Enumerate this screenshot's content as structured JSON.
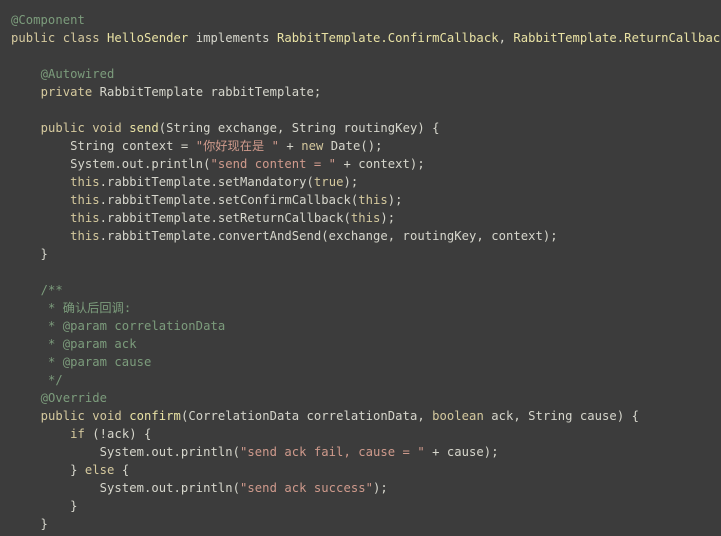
{
  "editor": {
    "language": "Java",
    "colors": {
      "background": "#3c3c3c",
      "plain": "#d6d6cc",
      "keyword": "#d5c99e",
      "declaration": "#e9e2a4",
      "string": "#cf9a8c",
      "annotation": "#7c9c7c",
      "comment": "#7c9c7c"
    },
    "lines": [
      [
        [
          "ann",
          "@Component"
        ]
      ],
      [
        [
          "kw",
          "public class "
        ],
        [
          "decl",
          "HelloSender"
        ],
        [
          "plain",
          " implements "
        ],
        [
          "decl",
          "RabbitTemplate.ConfirmCallback"
        ],
        [
          "plain",
          ", "
        ],
        [
          "decl",
          "RabbitTemplate.ReturnCallback"
        ],
        [
          "plain",
          "{"
        ]
      ],
      [],
      [
        [
          "plain",
          "    "
        ],
        [
          "ann",
          "@Autowired"
        ]
      ],
      [
        [
          "plain",
          "    "
        ],
        [
          "kw",
          "private "
        ],
        [
          "plain",
          "RabbitTemplate rabbitTemplate;"
        ]
      ],
      [],
      [
        [
          "plain",
          "    "
        ],
        [
          "kw",
          "public void "
        ],
        [
          "decl",
          "send"
        ],
        [
          "plain",
          "(String exchange, String routingKey) {"
        ]
      ],
      [
        [
          "plain",
          "        String context = "
        ],
        [
          "str",
          "\"你好现在是 \""
        ],
        [
          "plain",
          " + "
        ],
        [
          "kw",
          "new "
        ],
        [
          "plain",
          "Date();"
        ]
      ],
      [
        [
          "plain",
          "        System.out.println("
        ],
        [
          "str",
          "\"send content = \""
        ],
        [
          "plain",
          " + context);"
        ]
      ],
      [
        [
          "plain",
          "        "
        ],
        [
          "kw",
          "this"
        ],
        [
          "plain",
          ".rabbitTemplate.setMandatory("
        ],
        [
          "kw",
          "true"
        ],
        [
          "plain",
          ");"
        ]
      ],
      [
        [
          "plain",
          "        "
        ],
        [
          "kw",
          "this"
        ],
        [
          "plain",
          ".rabbitTemplate.setConfirmCallback("
        ],
        [
          "kw",
          "this"
        ],
        [
          "plain",
          ");"
        ]
      ],
      [
        [
          "plain",
          "        "
        ],
        [
          "kw",
          "this"
        ],
        [
          "plain",
          ".rabbitTemplate.setReturnCallback("
        ],
        [
          "kw",
          "this"
        ],
        [
          "plain",
          ");"
        ]
      ],
      [
        [
          "plain",
          "        "
        ],
        [
          "kw",
          "this"
        ],
        [
          "plain",
          ".rabbitTemplate.convertAndSend(exchange, routingKey, context);"
        ]
      ],
      [
        [
          "plain",
          "    }"
        ]
      ],
      [],
      [
        [
          "plain",
          "    "
        ],
        [
          "cmt",
          "/**"
        ]
      ],
      [
        [
          "plain",
          "     "
        ],
        [
          "cmt",
          "* 确认后回调:"
        ]
      ],
      [
        [
          "plain",
          "     "
        ],
        [
          "cmt",
          "* @param correlationData"
        ]
      ],
      [
        [
          "plain",
          "     "
        ],
        [
          "cmt",
          "* @param ack"
        ]
      ],
      [
        [
          "plain",
          "     "
        ],
        [
          "cmt",
          "* @param cause"
        ]
      ],
      [
        [
          "plain",
          "     "
        ],
        [
          "cmt",
          "*/"
        ]
      ],
      [
        [
          "plain",
          "    "
        ],
        [
          "ann",
          "@Override"
        ]
      ],
      [
        [
          "plain",
          "    "
        ],
        [
          "kw",
          "public void "
        ],
        [
          "decl",
          "confirm"
        ],
        [
          "plain",
          "(CorrelationData correlationData, "
        ],
        [
          "kw",
          "boolean "
        ],
        [
          "plain",
          "ack, String cause) {"
        ]
      ],
      [
        [
          "plain",
          "        "
        ],
        [
          "kw",
          "if "
        ],
        [
          "plain",
          "(!ack) {"
        ]
      ],
      [
        [
          "plain",
          "            System.out.println("
        ],
        [
          "str",
          "\"send ack fail, cause = \""
        ],
        [
          "plain",
          " + cause);"
        ]
      ],
      [
        [
          "plain",
          "        } "
        ],
        [
          "kw",
          "else "
        ],
        [
          "plain",
          "{"
        ]
      ],
      [
        [
          "plain",
          "            System.out.println("
        ],
        [
          "str",
          "\"send ack success\""
        ],
        [
          "plain",
          ");"
        ]
      ],
      [
        [
          "plain",
          "        }"
        ]
      ],
      [
        [
          "plain",
          "    }"
        ]
      ]
    ]
  }
}
